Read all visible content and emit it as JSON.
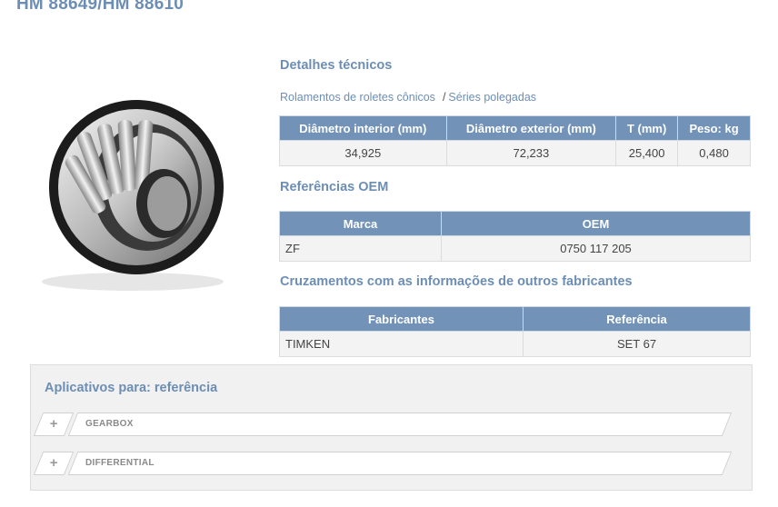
{
  "product": {
    "title": "HM 88649/HM 88610"
  },
  "technical": {
    "heading": "Detalhes técnicos",
    "breadcrumb": [
      "Rolamentos de roletes cônicos",
      "Séries polegadas"
    ],
    "breadcrumb_separator": "/",
    "columns": [
      "Diâmetro interior (mm)",
      "Diâmetro exterior (mm)",
      "T (mm)",
      "Peso: kg"
    ],
    "row": [
      "34,925",
      "72,233",
      "25,400",
      "0,480"
    ]
  },
  "oem": {
    "heading": "Referências OEM",
    "columns": [
      "Marca",
      "OEM"
    ],
    "rows": [
      [
        "ZF",
        "0750 117 205"
      ]
    ]
  },
  "cross": {
    "heading": "Cruzamentos com as informações de outros fabricantes",
    "columns": [
      "Fabricantes",
      "Referência"
    ],
    "rows": [
      [
        "TIMKEN",
        "SET 67"
      ]
    ]
  },
  "applications": {
    "title": "Aplicativos para: referência",
    "expand_symbol": "+",
    "items": [
      "GEARBOX",
      "DIFFERENTIAL"
    ]
  },
  "colors": {
    "accent": "#6d8eb4",
    "table_header": "#7292b8",
    "panel": "#f1f1f1"
  }
}
